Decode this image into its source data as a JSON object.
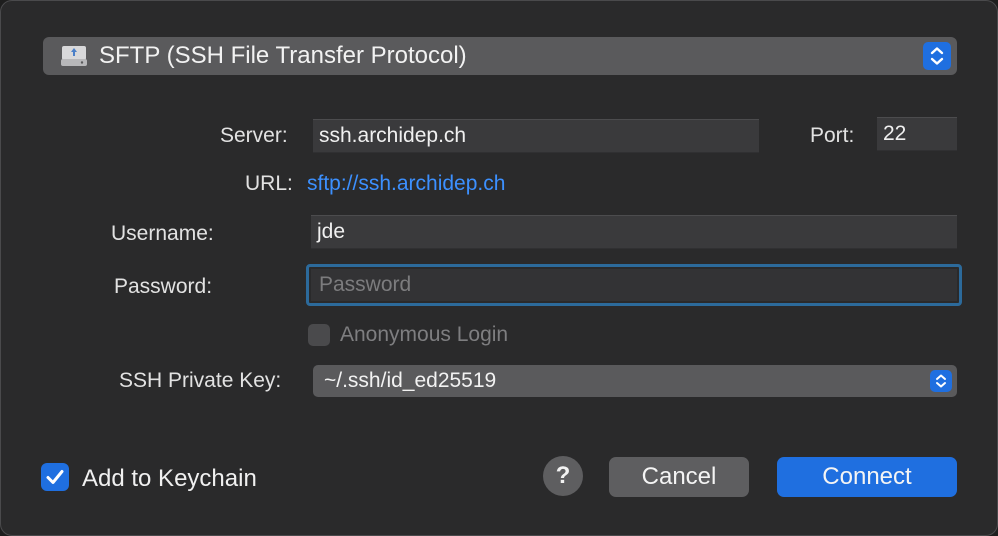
{
  "protocol": {
    "label": "SFTP (SSH File Transfer Protocol)",
    "icon": "external-drive-icon"
  },
  "server": {
    "label": "Server:",
    "value": "ssh.archidep.ch"
  },
  "port": {
    "label": "Port:",
    "value": "22"
  },
  "url": {
    "label": "URL:",
    "value": "sftp://ssh.archidep.ch"
  },
  "username": {
    "label": "Username:",
    "value": "jde"
  },
  "password": {
    "label": "Password:",
    "placeholder": "Password"
  },
  "anonymous": {
    "label": "Anonymous Login",
    "checked": false
  },
  "ssh_key": {
    "label": "SSH Private Key:",
    "value": "~/.ssh/id_ed25519"
  },
  "keychain": {
    "label": "Add to Keychain",
    "checked": true
  },
  "buttons": {
    "help": "?",
    "cancel": "Cancel",
    "connect": "Connect"
  },
  "colors": {
    "accent": "#1f6fe0",
    "link": "#3c90ff",
    "background": "#2a2a2b"
  }
}
